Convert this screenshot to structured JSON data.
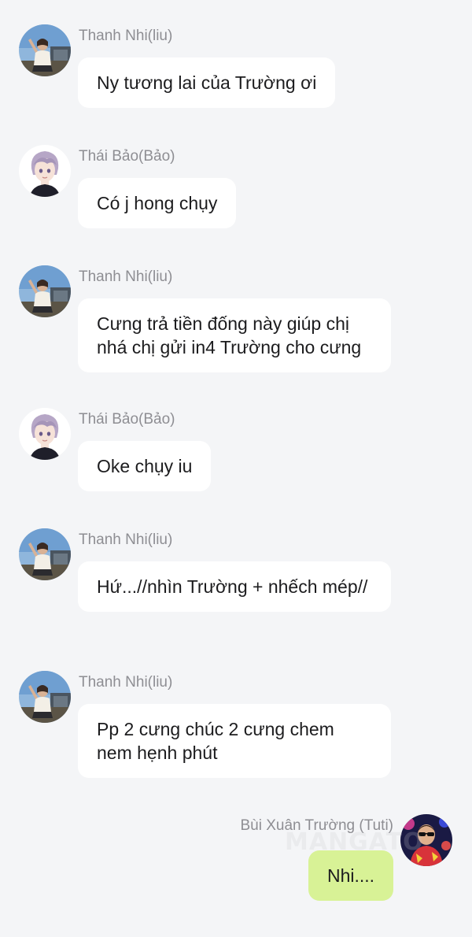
{
  "senders": {
    "thanh_nhi": "Thanh Nhi(liu)",
    "thai_bao": "Thái Bảo(Bảo)",
    "bui_xuan_truong": "Bùi Xuân Trường (Tuti)"
  },
  "messages": [
    {
      "sender": "Thanh Nhi(liu)",
      "text": "Ny tương lai của Trường ơi",
      "direction": "incoming",
      "avatar": "girl-photo-avatar"
    },
    {
      "sender": "Thái Bảo(Bảo)",
      "text": "Có j hong chụy",
      "direction": "incoming",
      "avatar": "anime-boy-avatar"
    },
    {
      "sender": "Thanh Nhi(liu)",
      "text": "Cưng trả tiền đống này giúp chị nhá chị gửi in4 Trường cho cưng",
      "direction": "incoming",
      "avatar": "girl-photo-avatar"
    },
    {
      "sender": "Thái Bảo(Bảo)",
      "text": "Oke chụy iu",
      "direction": "incoming",
      "avatar": "anime-boy-avatar"
    },
    {
      "sender": "Thanh Nhi(liu)",
      "text": "Hứ...//nhìn Trường + nhếch mép//",
      "direction": "incoming",
      "avatar": "girl-photo-avatar"
    },
    {
      "sender": "Thanh Nhi(liu)",
      "text": "Pp 2 cưng chúc 2 cưng chem nem hẹnh phút",
      "direction": "incoming",
      "avatar": "girl-photo-avatar"
    },
    {
      "sender": "Bùi Xuân Trường (Tuti)",
      "text": "Nhi....",
      "direction": "outgoing",
      "avatar": "boy-sunglasses-avatar"
    }
  ],
  "watermark": "MANGATO",
  "colors": {
    "background": "#f4f5f7",
    "incoming_bubble": "#ffffff",
    "outgoing_bubble": "#d8f296",
    "sender_name": "#8e8e93",
    "message_text": "#1c1c1e"
  }
}
